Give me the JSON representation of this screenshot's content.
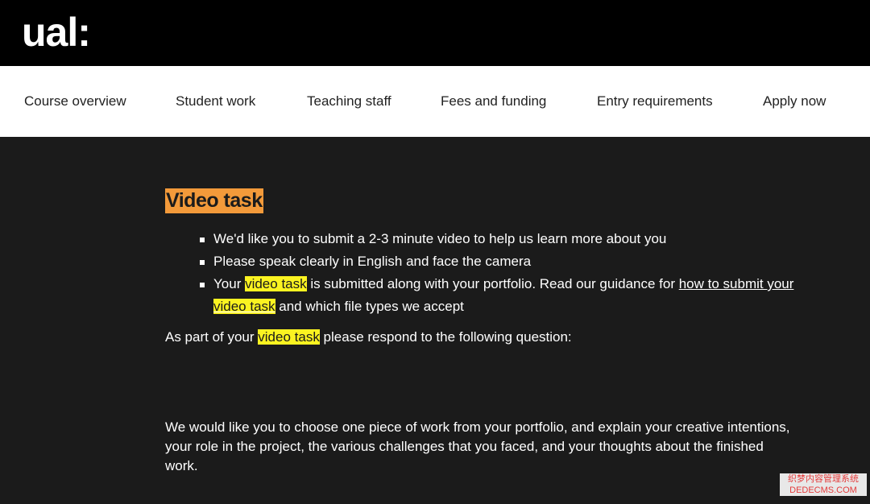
{
  "header": {
    "logo_text": "ual:"
  },
  "nav": {
    "items": [
      {
        "label": "Course overview"
      },
      {
        "label": "Student work"
      },
      {
        "label": "Teaching staff"
      },
      {
        "label": "Fees and funding"
      },
      {
        "label": "Entry requirements"
      },
      {
        "label": "Apply now"
      }
    ]
  },
  "main": {
    "heading": "Video task",
    "bullets": {
      "b1": "We'd like you to submit a 2-3 minute video to help us learn more about you",
      "b2": "Please speak clearly in English and face the camera",
      "b3_before": "Your ",
      "b3_highlight": "video task",
      "b3_middle": " is submitted along with your portfolio. Read our guidance for ",
      "b3_link_before": "how to submit your ",
      "b3_link_highlight": "video task",
      "b3_after": " and which file types we accept"
    },
    "intro": {
      "before": "As part of your ",
      "highlight": "video task",
      "after": " please respond to the following question:"
    },
    "question": "We would like you to choose one piece of work from your portfolio, and explain your creative intentions, your role in the project, the various challenges that you faced, and your thoughts about the finished work."
  },
  "watermark": {
    "line1": "织梦内容管理系统",
    "line2": "DEDECMS.COM"
  },
  "colors": {
    "heading_highlight": "#f39a3a",
    "text_highlight": "#fbf321",
    "background": "#1b1b1b",
    "topbar": "#000000"
  }
}
